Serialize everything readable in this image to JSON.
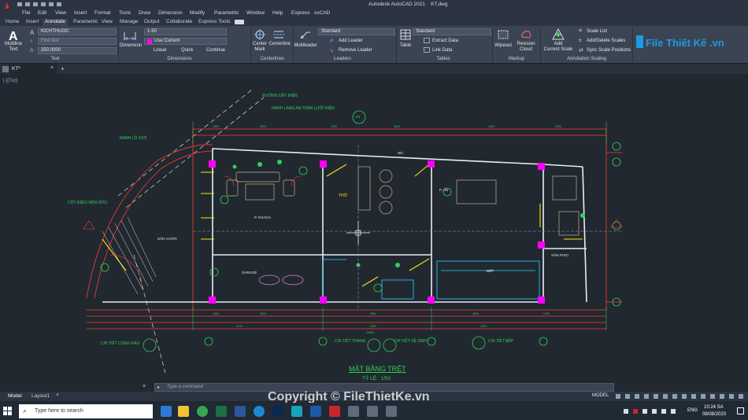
{
  "window": {
    "title": "Autodesk AutoCAD 2021    KT.dwg"
  },
  "menu": [
    "File",
    "Edit",
    "View",
    "Insert",
    "Format",
    "Tools",
    "Draw",
    "Dimension",
    "Modify",
    "Parametric",
    "Window",
    "Help",
    "Express",
    "sxCAD"
  ],
  "ribbon_tabs": [
    "Home",
    "Insert",
    "Annotate",
    "Parametric",
    "View",
    "Manage",
    "Output",
    "Collaborate",
    "Express Tools"
  ],
  "ribbon_active_tab": "Annotate",
  "ribbon": {
    "text_panel": {
      "label": "Text",
      "multiline_text": "Multiline\nText",
      "style_value": "KICHTHUOC",
      "find_placeholder": "Find text",
      "height_value": "250.0000"
    },
    "dimensions_panel": {
      "label": "Dimensions",
      "dimension_button": "Dimension",
      "style_value": "1-50",
      "layer_value": "Use Current",
      "linear": "Linear",
      "quick": "Quick",
      "continue": "Continue"
    },
    "centerlines_panel": {
      "label": "Centerlines",
      "center_mark": "Center\nMark",
      "centerline": "Centerline"
    },
    "leaders_panel": {
      "label": "Leaders",
      "multileader": "Multileader",
      "style_value": "Standard",
      "add_leader": "Add Leader",
      "remove_leader": "Remove Leader"
    },
    "tables_panel": {
      "label": "Tables",
      "table": "Table",
      "style_value": "Standard",
      "extract_data": "Extract Data",
      "link_data": "Link Data"
    },
    "markup_panel": {
      "label": "Markup",
      "wipeout": "Wipeout",
      "revision_cloud": "Revision\nCloud"
    },
    "annotation_scaling_panel": {
      "label": "Annotation Scaling",
      "add_current_scale": "Add\nCurrent Scale",
      "scale_list": "Scale List",
      "add_delete_scales": "Add/Delete Scales",
      "sync_scale_positions": "Sync Scale Positions"
    }
  },
  "doc_tab": "KT*",
  "drawing": {
    "title": "MẶT BẰNG TRỆT",
    "scale": "TỶ LỆ : 1/50",
    "labels": {
      "power_line": "ĐƯỜNG DÂY ĐIỆN",
      "safety_corridor": "HÀNH LANG AN TOÀN LƯỚI ĐIỆN",
      "boundary": "RANH LỘ GIỚI",
      "electric_pole": "CỘT ĐIỆN HIỆN HỮU",
      "gate_detail": "CHI TIẾT CỔNG RÀO",
      "stair_detail": "CHI TIẾT THANG",
      "wc_detail": "CHI TIẾT VỆ SINH",
      "kitchen_detail": "CHI TIẾT BẾP",
      "garage": "GARAGE",
      "living": "P. KHÁCH",
      "kitchen": "BẾP",
      "dining": "P. ĂN",
      "yard": "SÂN VƯỜN",
      "laundry": "SÂN PHƠI",
      "shrine": "THỜ",
      "wc": "WC",
      "north": "VN"
    }
  },
  "command_line": {
    "placeholder": "Type a command"
  },
  "layout_tabs": [
    "Model",
    "Layout1"
  ],
  "status": {
    "mode": "MODEL"
  },
  "taskbar": {
    "search_placeholder": "Type here to search",
    "time": "10:24 SA",
    "date": "08/08/2020",
    "language": "ENG"
  },
  "watermark": {
    "logo": "File Thiết Kế .vn",
    "copyright": "Copyright © FileThietKe.vn"
  },
  "colors": {
    "canvas": "#212830",
    "ribbon": "#3b4453",
    "accent_magenta": "#ff00ff",
    "line_red": "#ff3b30",
    "line_green": "#34d058",
    "line_yellow": "#ffe600",
    "line_cyan": "#2ad4ff"
  }
}
